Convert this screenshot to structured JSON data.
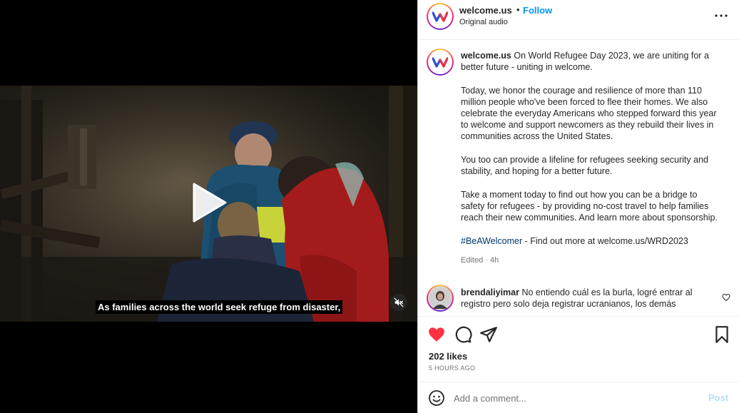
{
  "media": {
    "subtitle": "As families across the world seek refuge from disaster,",
    "play_icon": "play-icon",
    "mute_icon": "muted-speaker-icon"
  },
  "header": {
    "username": "welcome.us",
    "separator": "•",
    "follow_label": "Follow",
    "audio_label": "Original audio",
    "more_icon": "more-options-icon"
  },
  "caption": {
    "username": "welcome.us",
    "paragraphs": [
      "On World Refugee Day 2023, we are uniting for a better future - uniting in welcome.",
      "Today, we honor the courage and resilience of more than 110 million people who've been forced to flee their homes. We also celebrate the everyday Americans who stepped forward this year to welcome and support newcomers as they rebuild their lives in communities across the United States.",
      "You too can provide a lifeline for refugees seeking security and stability, and hoping for a better future.",
      "Take a moment today to find out how you can be a bridge to safety for refugees - by providing no-cost travel to help families reach their new communities. And learn more about sponsorship."
    ],
    "hashtag": "#BeAWelcomer",
    "hashtag_suffix": " - Find out more at welcome.us/WRD2023",
    "edited": "Edited · 4h"
  },
  "comment": {
    "username": "brendaliyimar",
    "text": "No entiendo cuál es la burla, logré entrar al registro pero solo deja registrar ucranianos, los demás"
  },
  "actions": {
    "likes": "202 likes",
    "time_ago": "5 HOURS AGO",
    "icons": [
      "heart-filled-icon",
      "comment-icon",
      "share-icon",
      "bookmark-icon"
    ]
  },
  "add_comment": {
    "placeholder": "Add a comment...",
    "post_label": "Post"
  },
  "colors": {
    "accent": "#0095f6",
    "like_red": "#ff3040",
    "hashtag": "#00376b",
    "post_disabled": "#b2dffc"
  }
}
